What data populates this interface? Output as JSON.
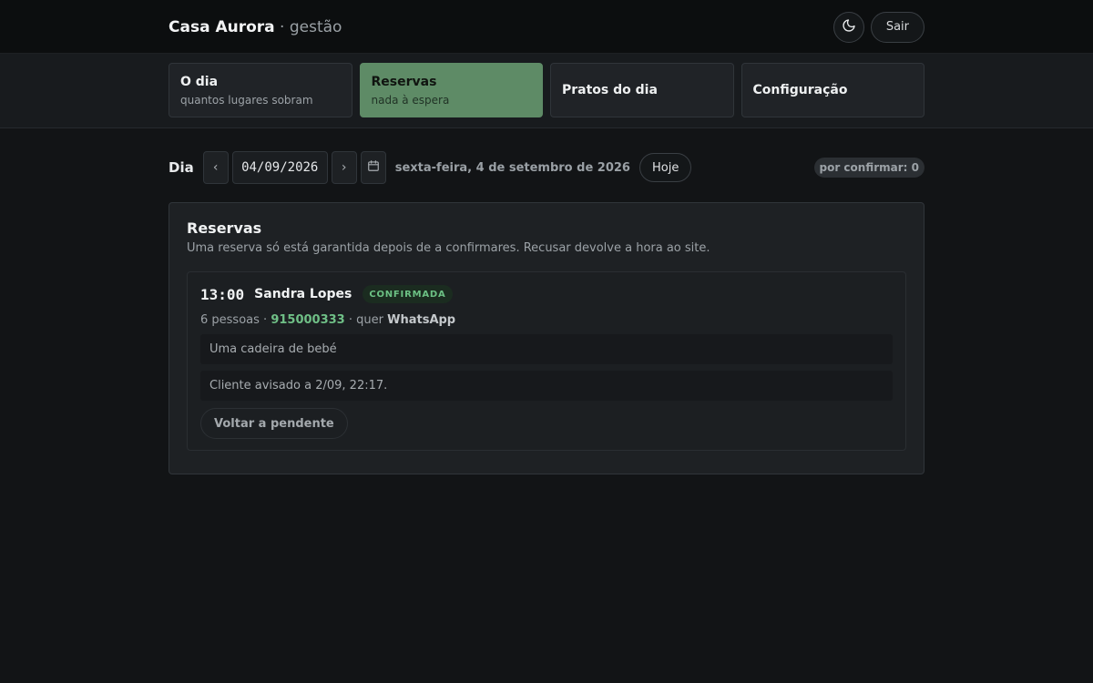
{
  "header": {
    "brand_name": "Casa Aurora",
    "brand_sep": " · ",
    "brand_sub": "gestão",
    "theme_icon": "moon-icon",
    "logout_label": "Sair"
  },
  "tabs": [
    {
      "title": "O dia",
      "subtitle": "quantos lugares sobram",
      "active": false
    },
    {
      "title": "Reservas",
      "subtitle": "nada à espera",
      "active": true
    },
    {
      "title": "Pratos do dia",
      "subtitle": "",
      "active": false
    },
    {
      "title": "Configuração",
      "subtitle": "",
      "active": false
    }
  ],
  "day": {
    "label": "Dia",
    "prev_icon": "‹",
    "next_icon": "›",
    "date_value": "04/09/2026",
    "calendar_icon": "calendar-icon",
    "date_long": "sexta-feira, 4 de setembro de 2026",
    "today_label": "Hoje",
    "pending_badge": "por confirmar: 0"
  },
  "reservations": {
    "title": "Reservas",
    "subtitle": "Uma reserva só está garantida depois de a confirmares. Recusar devolve a hora ao site.",
    "items": [
      {
        "time": "13:00",
        "name": "Sandra Lopes",
        "status": "CONFIRMADA",
        "people": "6 pessoas",
        "phone": "915000333",
        "channel_prefix": "quer",
        "channel": "WhatsApp",
        "notes": [
          "Uma cadeira de bebé",
          "Cliente avisado a 2/09, 22:17."
        ],
        "action_label": "Voltar a pendente"
      }
    ]
  },
  "colors": {
    "accent_green": "#5e8b66",
    "confirmed_text": "#6cc184",
    "background": "#121416"
  }
}
